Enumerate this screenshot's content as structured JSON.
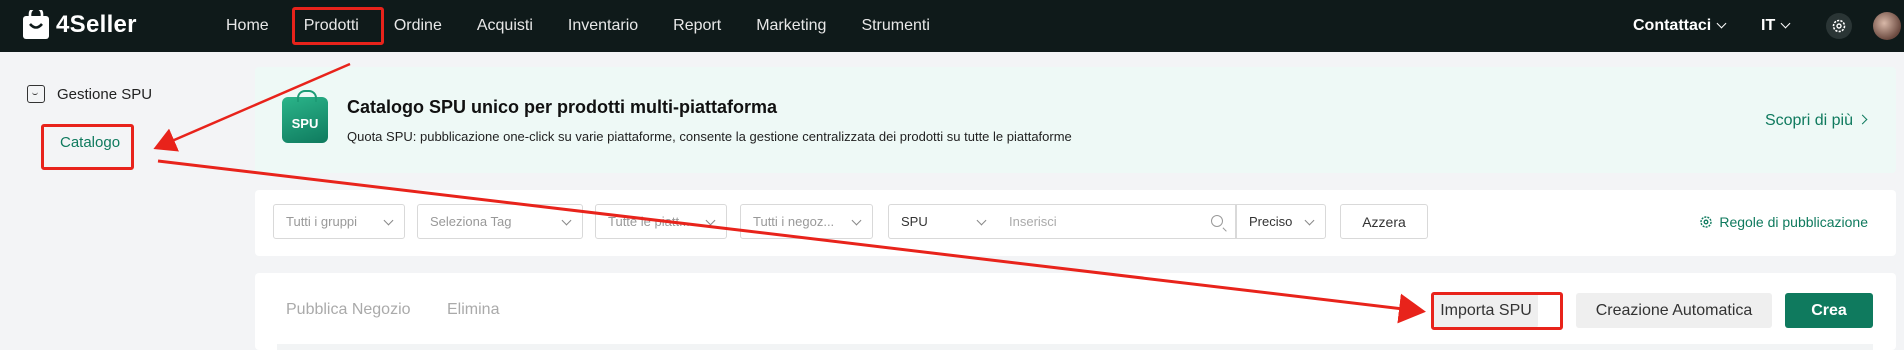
{
  "app": {
    "logo_text": "4Seller"
  },
  "nav": {
    "items": [
      "Home",
      "Prodotti",
      "Ordine",
      "Acquisti",
      "Inventario",
      "Report",
      "Marketing",
      "Strumenti"
    ],
    "contact_label": "Contattaci",
    "language": "IT"
  },
  "sidebar": {
    "section_title": "Gestione SPU",
    "item_label": "Catalogo"
  },
  "banner": {
    "badge": "SPU",
    "title": "Catalogo SPU unico per prodotti multi-piattaforma",
    "subtitle": "Quota SPU: pubblicazione one-click su varie piattaforme, consente la gestione centralizzata dei prodotti su tutte le piattaforme",
    "link": "Scopri di più"
  },
  "filters": {
    "groups_placeholder": "Tutti i gruppi",
    "tag_placeholder": "Seleziona Tag",
    "platform_placeholder": "Tutte le piatt...",
    "stores_placeholder": "Tutti i negoz...",
    "search_field": "SPU",
    "search_placeholder": "Inserisci",
    "match_mode": "Preciso",
    "reset_label": "Azzera",
    "rules_label": "Regole di pubblicazione"
  },
  "actions": {
    "publish_store": "Pubblica Negozio",
    "delete": "Elimina",
    "import_spu": "Importa SPU",
    "auto_create": "Creazione Automatica",
    "create": "Crea"
  },
  "colors": {
    "brand_green": "#0f7a5e",
    "topbar_bg": "#0f1a1a",
    "annotation_red": "#e8231b"
  }
}
